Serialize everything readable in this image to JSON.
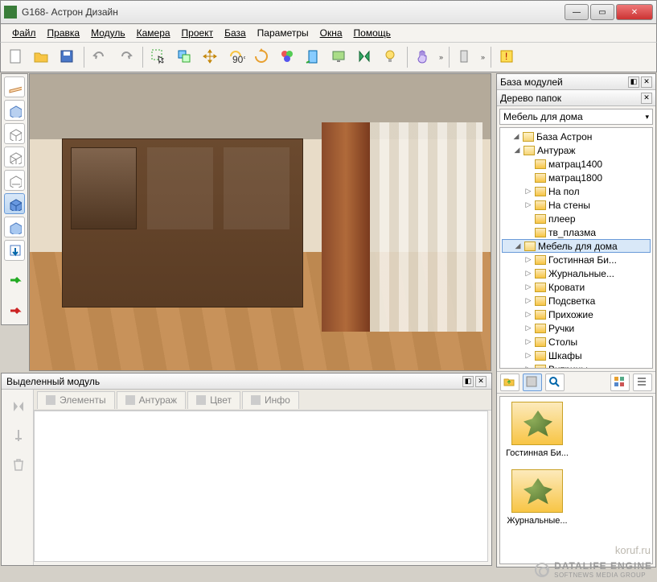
{
  "window": {
    "title": "G168- Астрон Дизайн"
  },
  "menu": {
    "file": "Файл",
    "edit": "Правка",
    "module": "Модуль",
    "camera": "Камера",
    "project": "Проект",
    "base": "База",
    "params": "Параметры",
    "windows": "Окна",
    "help": "Помощь"
  },
  "toolbar_icons": {
    "new": "new-file-icon",
    "open": "open-folder-icon",
    "save": "save-icon",
    "undo": "undo-icon",
    "redo": "redo-icon",
    "select": "select-cursor-icon",
    "copy": "copy-icon",
    "move": "move-icon",
    "rotate90": "rotate-90-icon",
    "rotate": "rotate-icon",
    "palette": "palette-icon",
    "exit": "door-icon",
    "screen": "screen-icon",
    "mirror": "mirror-icon",
    "bulb": "lightbulb-icon",
    "hand": "hand-icon",
    "device": "device-icon",
    "warn": "warning-icon"
  },
  "right": {
    "modules_title": "База модулей",
    "tree_title": "Дерево папок",
    "dropdown_value": "Мебель для дома",
    "tree": {
      "root": "База Астрон",
      "anturazh": "Антураж",
      "items_anturazh": [
        "матрац1400",
        "матрац1800",
        "На пол",
        "На стены",
        "плеер",
        "тв_плазма"
      ],
      "furniture": "Мебель для дома",
      "items_furniture": [
        "Гостинная Би...",
        "Журнальные...",
        "Кровати",
        "Подсветка",
        "Прихожие",
        "Ручки",
        "Столы",
        "Шкафы",
        "Витрины"
      ]
    },
    "thumbs": {
      "a": "Гостинная Би...",
      "b": "Журнальные..."
    }
  },
  "bottom": {
    "title": "Выделенный модуль",
    "tabs": {
      "elements": "Элементы",
      "anturazh": "Антураж",
      "color": "Цвет",
      "info": "Инфо"
    }
  },
  "watermark": {
    "brand": "DATALIFE ENGINE",
    "sub": "SOFTNEWS MEDIA GROUP",
    "site": "koruf.ru"
  }
}
